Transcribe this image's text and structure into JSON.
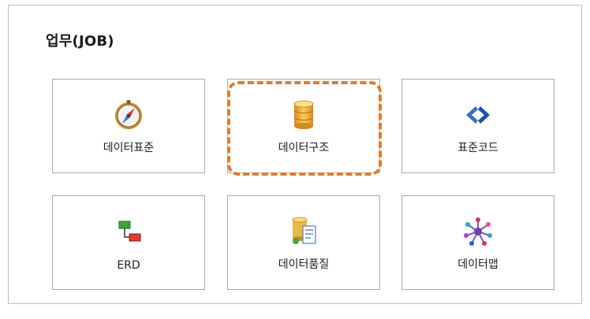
{
  "section": {
    "title": "업무(JOB)"
  },
  "tiles": [
    {
      "label": "데이터표준",
      "icon": "compass-icon"
    },
    {
      "label": "데이터구조",
      "icon": "database-icon"
    },
    {
      "label": "표준코드",
      "icon": "code-icon"
    },
    {
      "label": "ERD",
      "icon": "erd-diagram-icon"
    },
    {
      "label": "데이터품질",
      "icon": "data-quality-icon"
    },
    {
      "label": "데이터맵",
      "icon": "data-map-network-icon"
    }
  ],
  "colors": {
    "highlight": "#e07b2e",
    "tile_border": "#a9a9a9"
  }
}
